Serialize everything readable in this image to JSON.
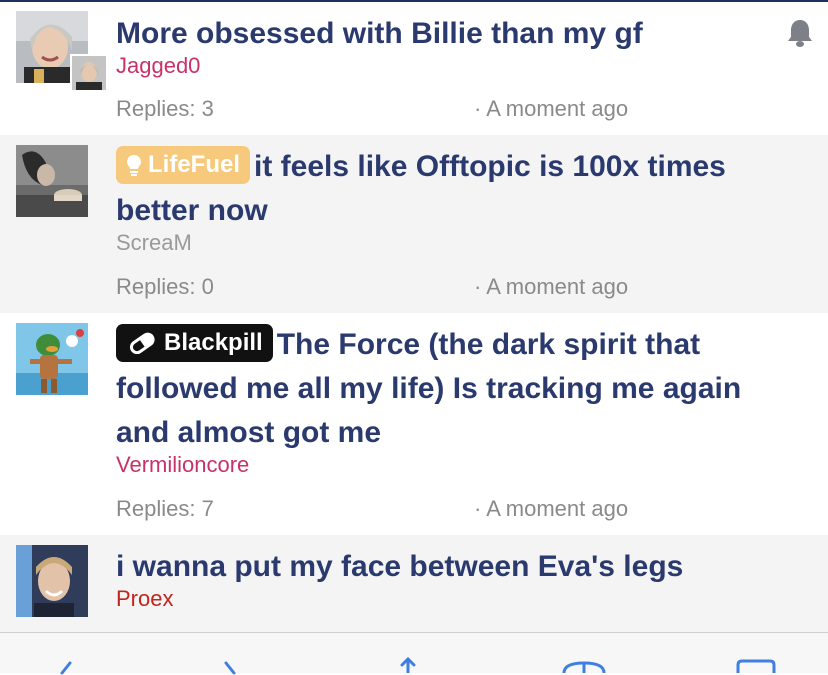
{
  "threads": [
    {
      "title": "More obsessed with Billie than my gf",
      "author": "Jagged0",
      "replies": "Replies: 3",
      "time": "· A moment ago",
      "has_bell": true
    },
    {
      "prefix": "LifeFuel",
      "title": "it feels like Offtopic is 100x times better now",
      "author": "ScreaM",
      "replies": "Replies: 0",
      "time": "· A moment ago"
    },
    {
      "prefix": "Blackpill",
      "title": "The Force (the dark spirit that followed me all my life) Is tracking me again and almost got me",
      "author": "Vermilioncore",
      "replies": "Replies: 7",
      "time": "· A moment ago"
    },
    {
      "title": "i wanna put my face between Eva's legs",
      "author": "Proex"
    }
  ],
  "colors": {
    "title": "#2b3a6e",
    "lifefuel_prefix": "#f7c97c",
    "blackpill_prefix": "#111111",
    "author_red": "#c8326a",
    "author_gray": "#9a9a9a",
    "alt_row_bg": "#f4f4f4"
  },
  "icons": {
    "bell": "bell-icon",
    "lifefuel": "lightbulb-icon",
    "blackpill": "pill-icon",
    "toolbar": [
      "back-icon",
      "forward-icon",
      "share-icon",
      "bookmarks-icon",
      "tabs-icon"
    ]
  }
}
